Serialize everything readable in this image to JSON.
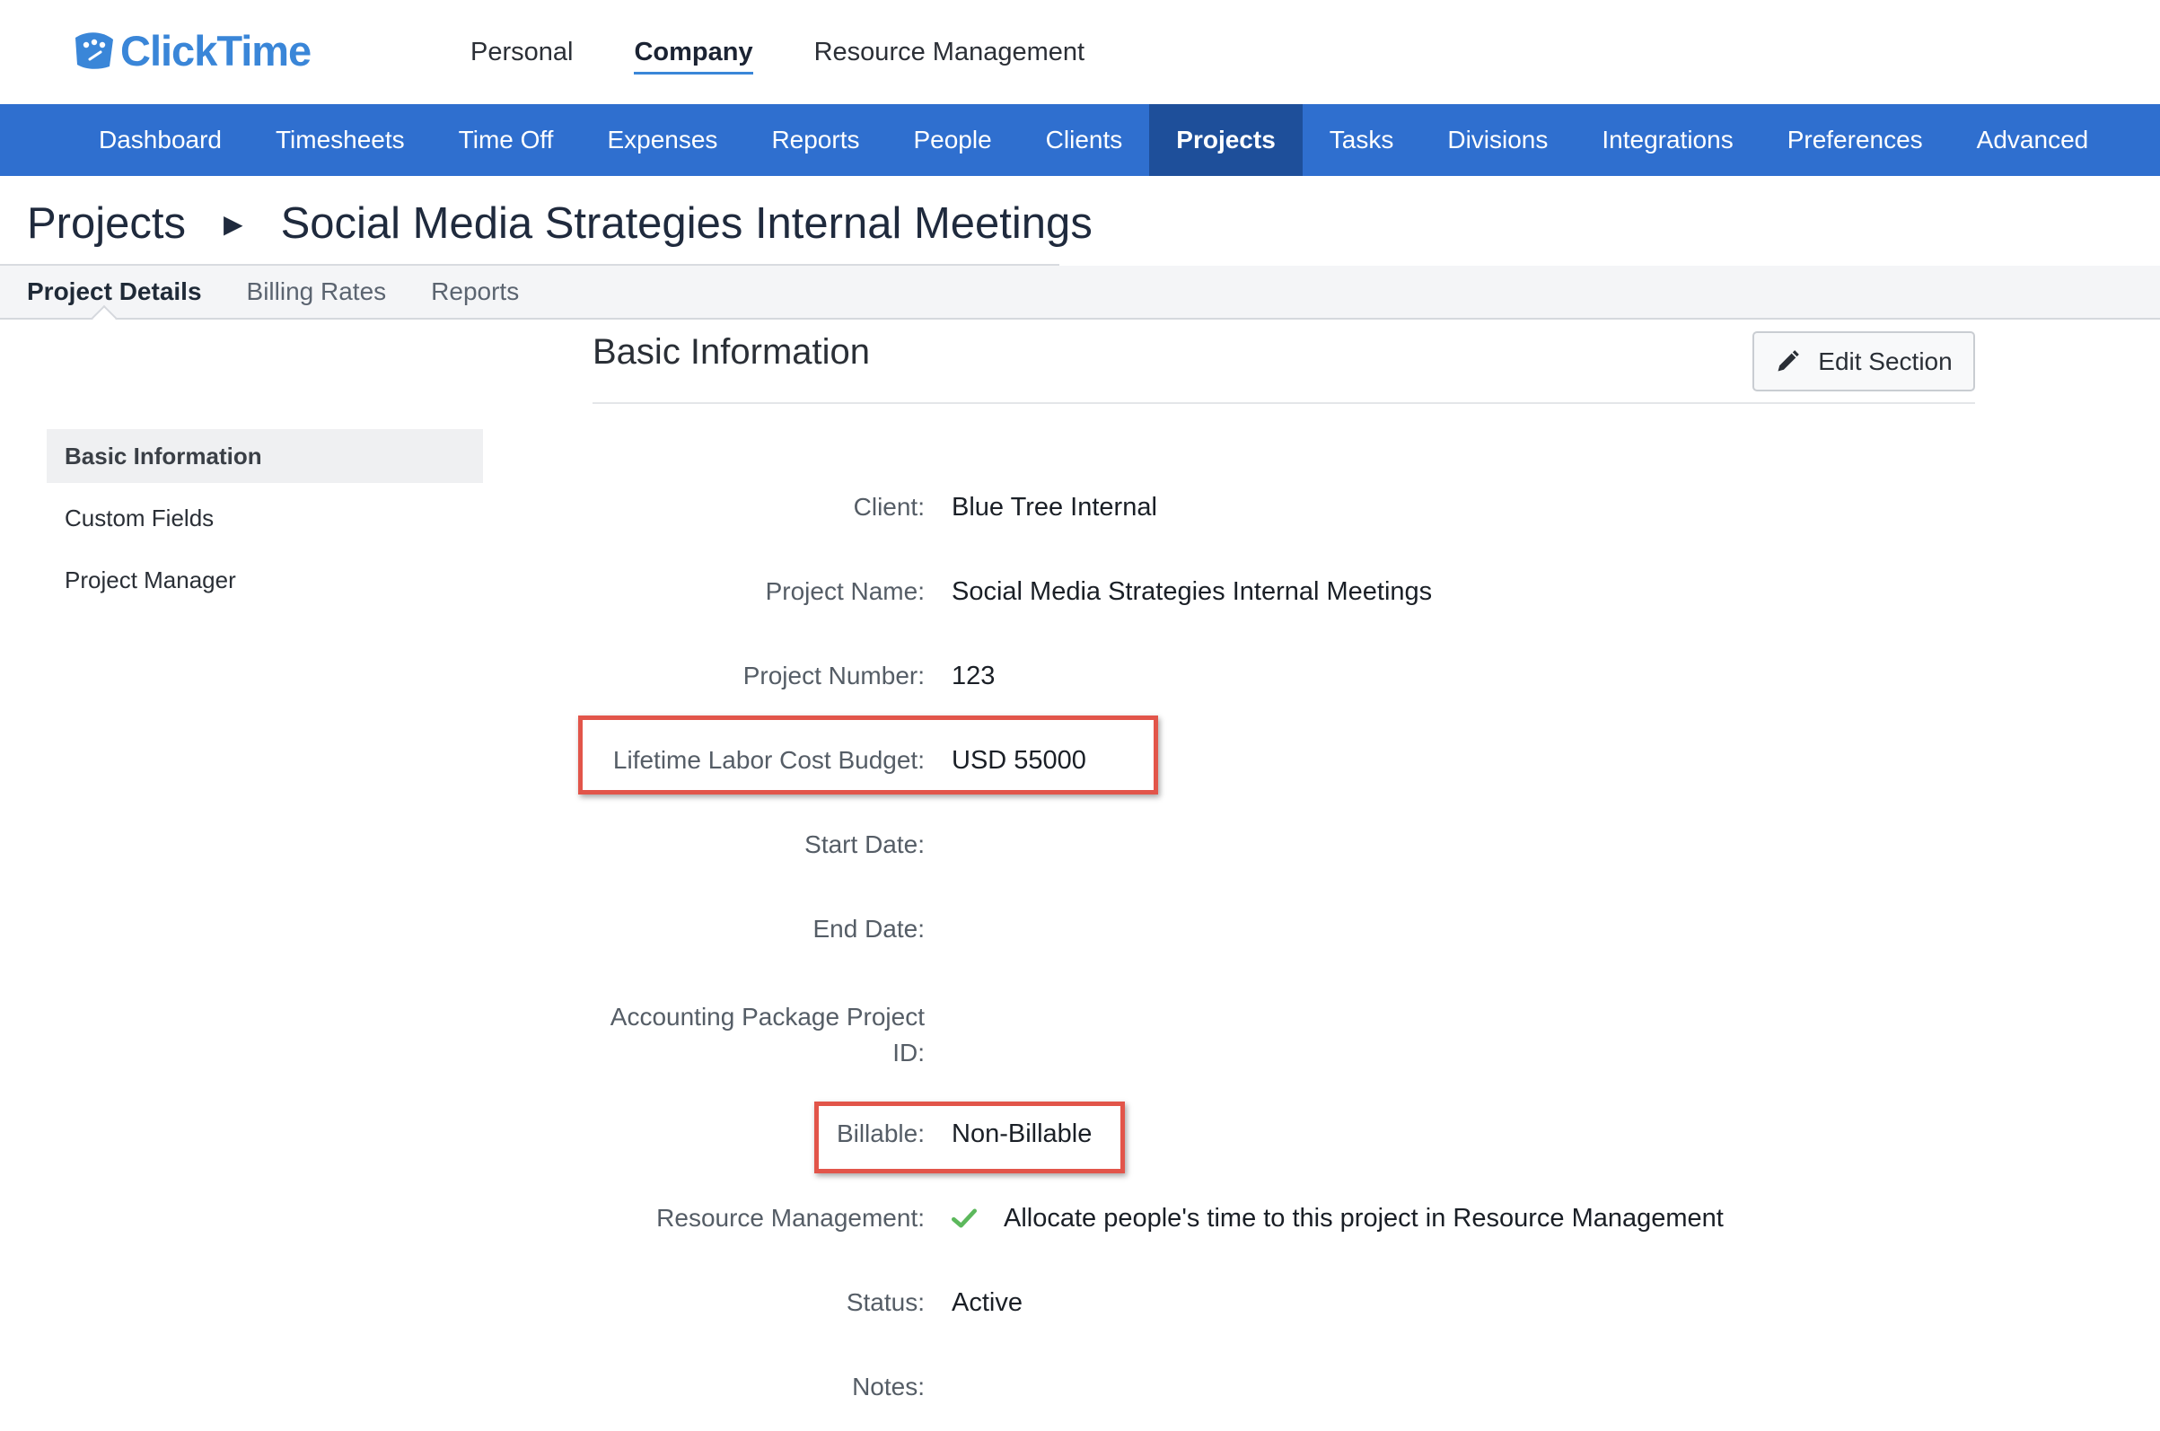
{
  "brand": {
    "name": "ClickTime",
    "color": "#3a86d8"
  },
  "top_tabs": [
    {
      "label": "Personal",
      "active": false
    },
    {
      "label": "Company",
      "active": true
    },
    {
      "label": "Resource Management",
      "active": false
    }
  ],
  "main_nav": [
    {
      "label": "Dashboard"
    },
    {
      "label": "Timesheets"
    },
    {
      "label": "Time Off"
    },
    {
      "label": "Expenses"
    },
    {
      "label": "Reports"
    },
    {
      "label": "People"
    },
    {
      "label": "Clients"
    },
    {
      "label": "Projects",
      "active": true
    },
    {
      "label": "Tasks"
    },
    {
      "label": "Divisions"
    },
    {
      "label": "Integrations"
    },
    {
      "label": "Preferences"
    },
    {
      "label": "Advanced"
    }
  ],
  "breadcrumb": {
    "root": "Projects",
    "current": "Social Media Strategies Internal Meetings"
  },
  "sub_tabs": [
    {
      "label": "Project Details",
      "active": true
    },
    {
      "label": "Billing Rates"
    },
    {
      "label": "Reports"
    }
  ],
  "side_menu": [
    {
      "label": "Basic Information",
      "active": true
    },
    {
      "label": "Custom Fields"
    },
    {
      "label": "Project Manager"
    }
  ],
  "section": {
    "title": "Basic Information",
    "edit_label": "Edit Section"
  },
  "fields": {
    "client": {
      "label": "Client:",
      "value": "Blue Tree Internal"
    },
    "project_name": {
      "label": "Project Name:",
      "value": "Social Media Strategies Internal Meetings"
    },
    "project_number": {
      "label": "Project Number:",
      "value": "123"
    },
    "labor_budget": {
      "label": "Lifetime Labor Cost Budget:",
      "value": "USD 55000"
    },
    "start_date": {
      "label": "Start Date:",
      "value": ""
    },
    "end_date": {
      "label": "End Date:",
      "value": ""
    },
    "accounting_id": {
      "label": "Accounting Package Project ID:",
      "value": ""
    },
    "billable": {
      "label": "Billable:",
      "value": "Non-Billable"
    },
    "resource_mgmt": {
      "label": "Resource Management:",
      "value": "Allocate people's time to this project in Resource Management",
      "checked": true
    },
    "status": {
      "label": "Status:",
      "value": "Active"
    },
    "notes": {
      "label": "Notes:",
      "value": ""
    }
  },
  "colors": {
    "nav_bg": "#2f6fcf",
    "nav_active": "#1e4f9a",
    "highlight": "#e2554a",
    "check": "#5cb85c"
  }
}
